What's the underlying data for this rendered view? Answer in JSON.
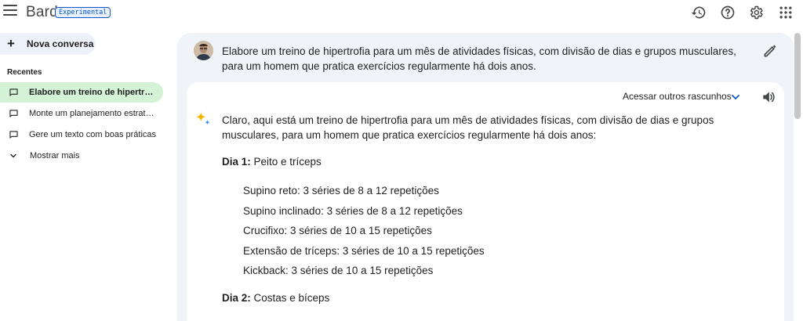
{
  "header": {
    "brand": "Bard",
    "badge": "Experimental",
    "icons": [
      "history-icon",
      "help-icon",
      "settings-icon",
      "apps-icon"
    ]
  },
  "sidebar": {
    "new_chat_label": "Nova conversa",
    "recent_title": "Recentes",
    "items": [
      {
        "label": "Elabore um treino de hipertrofia",
        "active": true
      },
      {
        "label": "Monte um planejamento estratégico",
        "active": false
      },
      {
        "label": "Gere um texto com boas práticas",
        "active": false
      }
    ],
    "show_more_label": "Mostrar mais"
  },
  "conversation": {
    "prompt": "Elabore um treino de hipertrofia para um mês de atividades físicas, com divisão de dias e grupos musculares, para um homem que pratica exercícios regularmente há dois anos.",
    "drafts_label": "Acessar outros rascunhos",
    "response": {
      "intro": "Claro, aqui está um treino de hipertrofia para um mês de atividades físicas, com divisão de dias e grupos musculares, para um homem que pratica exercícios regularmente há dois anos:",
      "day1": {
        "prefix": "Dia 1:",
        "title": " Peito e tríceps"
      },
      "day1_exercises": [
        "Supino reto: 3 séries de 8 a 12 repetições",
        "Supino inclinado: 3 séries de 8 a 12 repetições",
        "Crucifixo: 3 séries de 10 a 15 repetições",
        "Extensão de tríceps: 3 séries de 10 a 15 repetições",
        "Kickback: 3 séries de 10 a 15 repetições"
      ],
      "day2": {
        "prefix": "Dia 2:",
        "title": " Costas e bíceps"
      }
    }
  },
  "colors": {
    "accent": "#0b57d0",
    "active_item_bg": "#d3f2d6",
    "main_bg": "#f0f4f9",
    "new_chat_bg": "#edf2fa"
  }
}
